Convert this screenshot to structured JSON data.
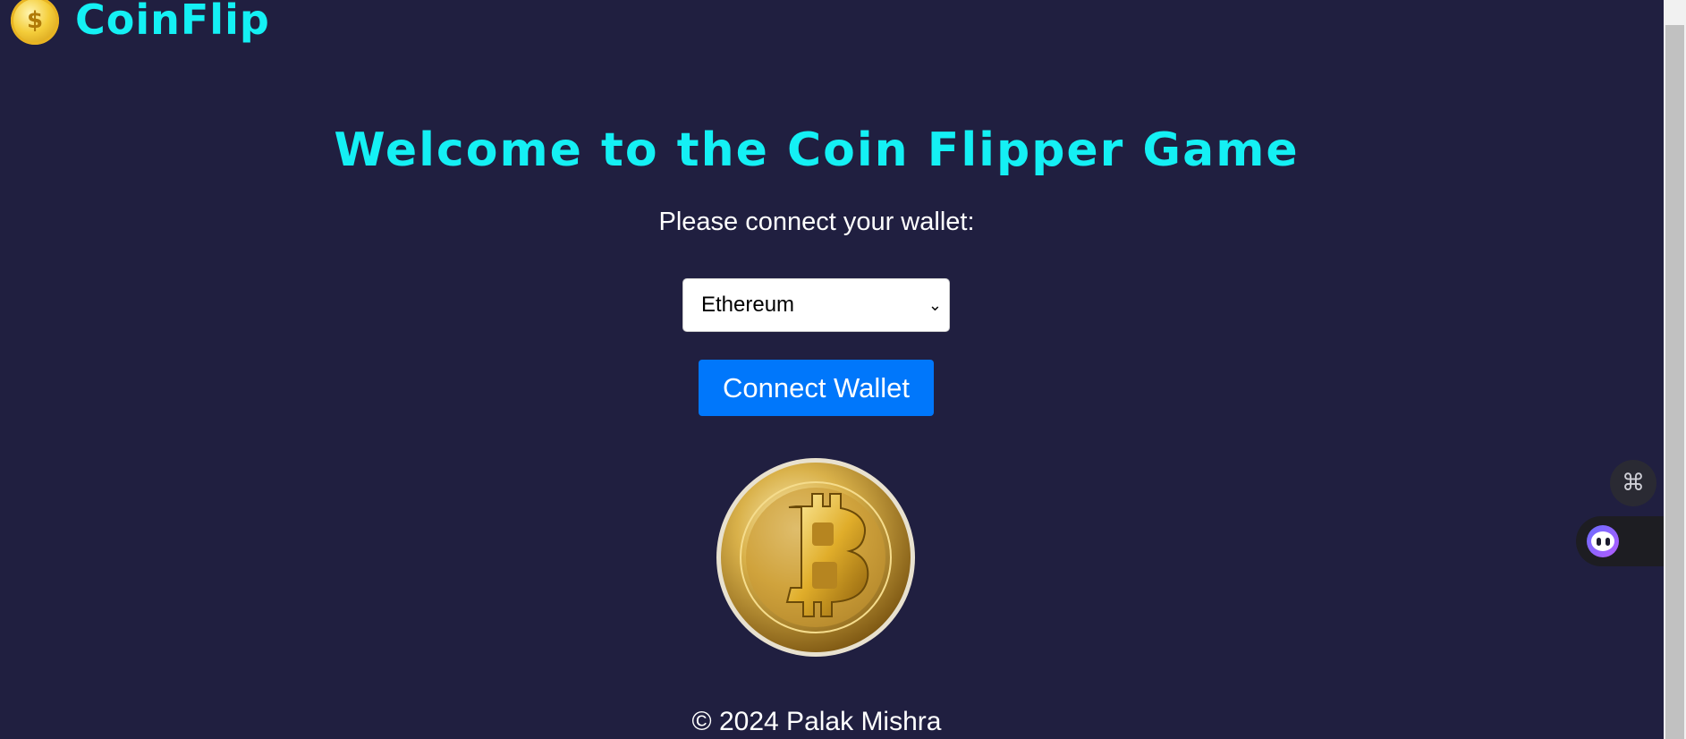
{
  "header": {
    "brand": "CoinFlip",
    "logo_icon": "coin-icon"
  },
  "main": {
    "title": "Welcome to the Coin Flipper Game",
    "prompt": "Please connect your wallet:",
    "wallet_select": {
      "selected": "Ethereum"
    },
    "connect_label": "Connect Wallet",
    "coin_image": "bitcoin-coin-image"
  },
  "footer": {
    "copyright": "© 2024 Palak Mishra"
  },
  "floating": {
    "command_icon": "command-icon",
    "assistant_icon": "assistant-bot-icon"
  },
  "colors": {
    "background": "#201f40",
    "accent": "#14f0f4",
    "button": "#0077fb"
  }
}
